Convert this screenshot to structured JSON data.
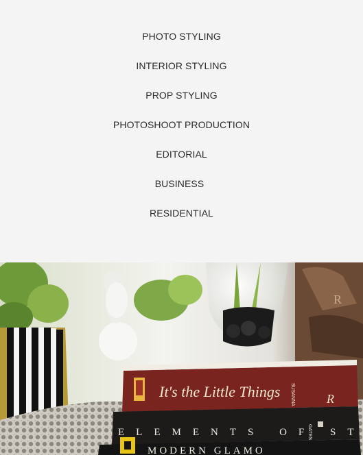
{
  "menu": {
    "items": [
      {
        "label": "PHOTO STYLING"
      },
      {
        "label": "INTERIOR STYLING"
      },
      {
        "label": "PROP STYLING"
      },
      {
        "label": "PHOTOSHOOT PRODUCTION"
      },
      {
        "label": "EDITORIAL"
      },
      {
        "label": "BUSINESS"
      },
      {
        "label": "RESIDENTIAL"
      }
    ]
  },
  "photo": {
    "books": {
      "top": "It's the Little Things",
      "top_author": "SUSANNA SALK",
      "top_publisher": "R",
      "middle": "ELEMENTS OF STYLE",
      "middle_author": "GATES",
      "bottom": "MODERN GLAMO"
    }
  },
  "colors": {
    "background": "#f4f4f4",
    "menu_text": "#2a2a2a",
    "book_top": "#7a2420",
    "book_middle": "#1d1a1a",
    "book_bottom": "#141414",
    "accent_yellow": "#e8c417"
  }
}
